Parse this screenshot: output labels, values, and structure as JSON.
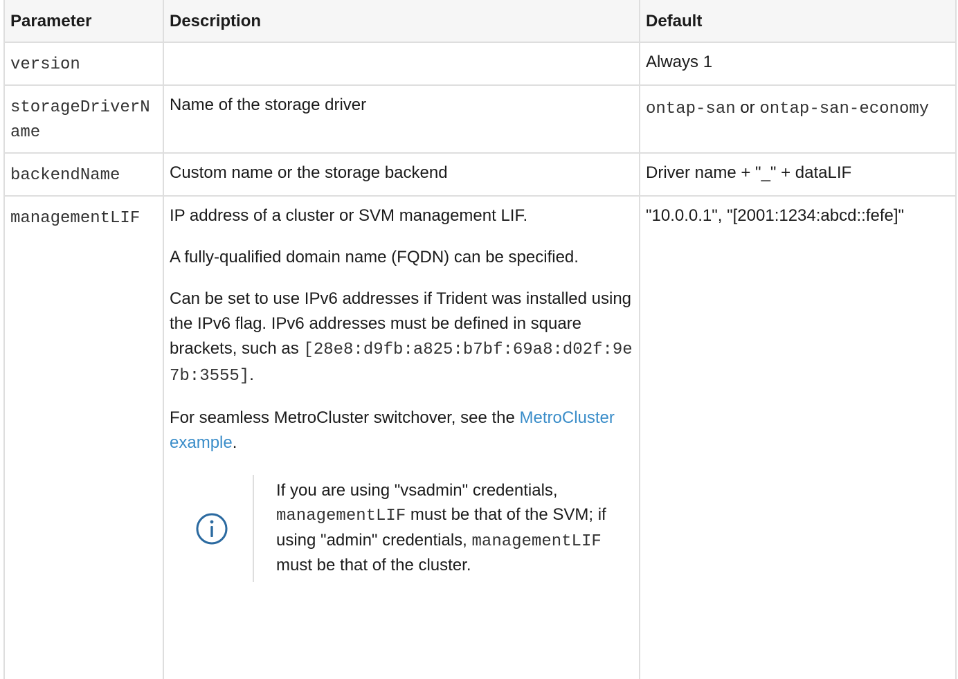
{
  "table": {
    "headers": {
      "parameter": "Parameter",
      "description": "Description",
      "default": "Default"
    },
    "rows": [
      {
        "parameter": "version",
        "description": "",
        "default": "Always 1"
      },
      {
        "parameter": "storageDriverName",
        "description": "Name of the storage driver",
        "default_mono1": "ontap-san",
        "default_or": " or ",
        "default_mono2": "ontap-san-economy"
      },
      {
        "parameter": "backendName",
        "description": "Custom name or the storage backend",
        "default": "Driver name + \"_\" + dataLIF"
      },
      {
        "parameter": "managementLIF",
        "description_p1": "IP address of a cluster or SVM management LIF.",
        "description_p2": "A fully-qualified domain name (FQDN) can be specified.",
        "description_p3": "Can be set to use IPv6 addresses if Trident was installed using the IPv6 flag. IPv6 addresses must be defined in square brackets, such as ",
        "description_p3_code": "[28e8:d9fb:a825:b7bf:69a8:d02f:9e7b:3555]",
        "description_p3_end": ".",
        "description_p4": "For seamless MetroCluster switchover, see the ",
        "description_p4_link": "MetroCluster example",
        "description_p4_end": ".",
        "note": {
          "icon": "info-icon",
          "text1": "If you are using \"vsadmin\" credentials, ",
          "code1": "managementLIF",
          "text2": " must be that of the SVM; if using \"admin\" credentials, ",
          "code2": "managementLIF",
          "text3": " must be that of the cluster."
        },
        "default": "\"10.0.0.1\", \"[2001:1234:abcd::fefe]\""
      }
    ]
  },
  "colors": {
    "link": "#3a8dc9",
    "header_bg": "#f6f6f6",
    "border": "#dedede"
  }
}
